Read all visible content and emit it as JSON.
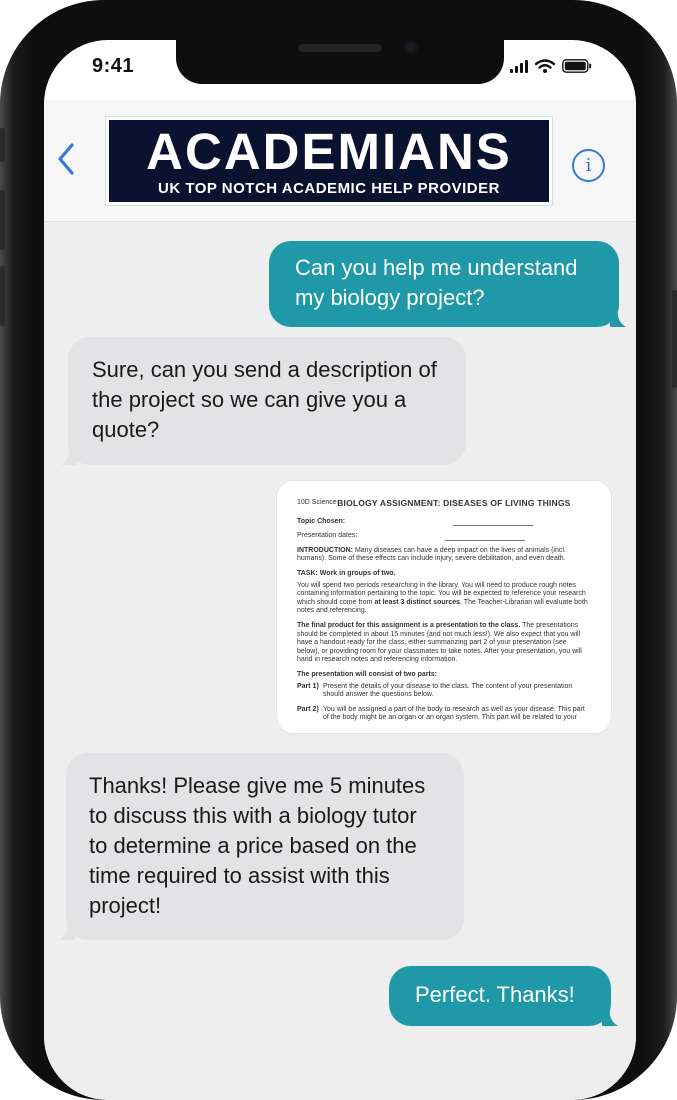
{
  "status_bar": {
    "time": "9:41"
  },
  "header": {
    "back_icon": "chevron-left-icon",
    "logo_title": "ACADEMIANS",
    "logo_subtitle": "UK TOP NOTCH ACADEMIC HELP PROVIDER",
    "info_glyph": "i"
  },
  "messages": [
    {
      "sender": "user",
      "text": "Can you help me understand my biology project?"
    },
    {
      "sender": "agent",
      "text": "Sure, can you send a description of the project so we can give you a quote?"
    },
    {
      "sender": "user",
      "type": "attachment",
      "description": "photo of assignment sheet"
    },
    {
      "sender": "agent",
      "text": "Thanks! Please give me 5 minutes to discuss this with a biology tutor to determine a price based on the time required to assist with this project!"
    },
    {
      "sender": "user",
      "text": "Perfect. Thanks!"
    }
  ],
  "document": {
    "course": "10D Science",
    "title": "BIOLOGY ASSIGNMENT: DISEASES OF LIVING THINGS",
    "topic_label": "Topic Chosen:",
    "dates_label": "Presentation dates:",
    "intro_label": "INTRODUCTION:",
    "intro_text": "Many diseases can have a deep impact on the lives of animals (incl. humans). Some of these effects can include injury, severe debilitation, and even death.",
    "task_label": "TASK:  Work in groups of two.",
    "task_text_1": "You will spend two periods researching in the library. You will need to produce rough notes containing information pertaining to the topic.  You will be expected to reference your research which should come from",
    "task_bold": "at least 3 distinct sources",
    "task_text_2": ". The Teacher-Librarian will evaluate both notes and referencing.",
    "final_bold": "The final product for this assignment is a presentation to the class.",
    "final_text": "The presentations should be completed in about 15 minutes (and not much less!). We also expect that you will have a handout ready for the class, either summarizing part 2 of your presentation (see below), or providing room for your classmates to take notes. After your presentation, you will hand in research notes and referencing information.",
    "parts_label": "The presentation will consist of two parts:",
    "part1_label": "Part 1)",
    "part1_text": "Present the details of your disease to the class. The content of your presentation should answer the questions below.",
    "part2_label": "Part 2)",
    "part2_text": "You will be assigned a part of the body to research as well as your disease. This part of the body might be an organ or an organ system. This part will be related to your"
  },
  "colors": {
    "outgoing_bubble": "#1f98a8",
    "incoming_bubble": "#e3e3e5",
    "accent": "#3478d8",
    "logo_bg": "#0b1230"
  }
}
